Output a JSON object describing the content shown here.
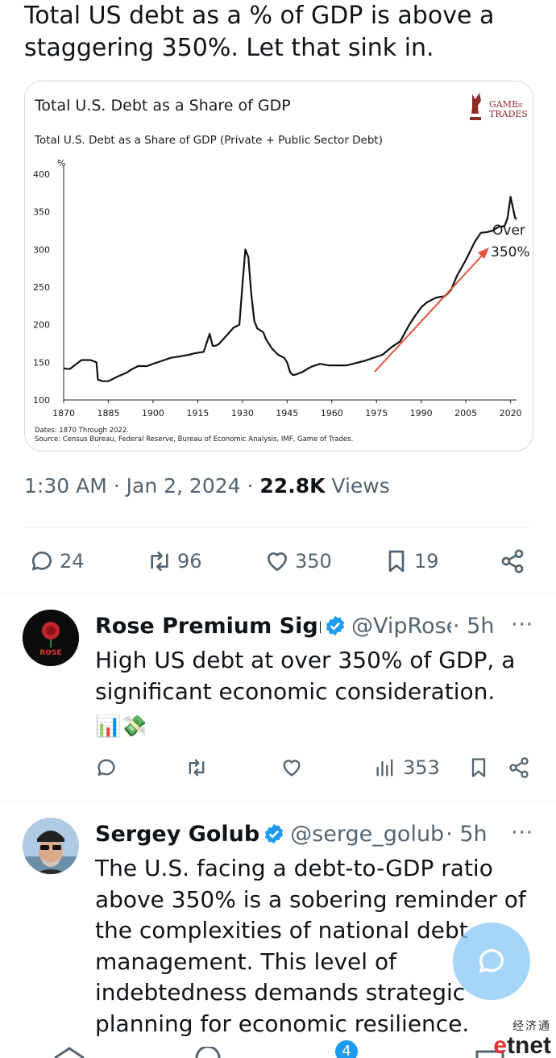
{
  "tweet": {
    "text": "Total US debt as a % of GDP is above a staggering 350%. Let that sink in.",
    "time": "1:30 AM",
    "date": "Jan 2, 2024",
    "views_count": "22.8K",
    "views_label": "Views",
    "replies": "24",
    "retweets": "96",
    "likes": "350",
    "bookmarks": "19"
  },
  "chart_data": {
    "type": "line",
    "title": "Total U.S. Debt as a Share of GDP",
    "subtitle": "Total U.S. Debt as a Share of GDP (Private + Public Sector Debt)",
    "ylabel": "%",
    "brand": "Game of Trades",
    "brand_line1": "GAME",
    "brand_of": "OF",
    "brand_line2": "TRADES",
    "annotation_line1": "Over",
    "annotation_line2": "350%",
    "footnote_dates": "Dates: 1870 Through 2022.",
    "footnote_source": "Source: Census Bureau, Federal Reserve, Bureau of Economic Analysis, IMF, Game of Trades.",
    "xlim": [
      1870,
      2022
    ],
    "ylim": [
      100,
      400
    ],
    "x_ticks": [
      1870,
      1885,
      1900,
      1915,
      1930,
      1945,
      1960,
      1975,
      1990,
      2005,
      2020
    ],
    "y_ticks": [
      100,
      150,
      200,
      250,
      300,
      350,
      400
    ],
    "grid": false,
    "line_color": "#111111",
    "arrow_color": "#e0523a",
    "series": [
      {
        "x": [
          1870,
          1872,
          1876,
          1879,
          1881,
          1881.5,
          1883,
          1885,
          1888,
          1891,
          1893,
          1895,
          1898,
          1900,
          1903,
          1906,
          1909,
          1912,
          1914,
          1917,
          1919,
          1920,
          1921,
          1922,
          1925,
          1927,
          1929,
          1930,
          1931,
          1932,
          1933,
          1934,
          1935,
          1937,
          1938,
          1940,
          1942,
          1944,
          1945,
          1946,
          1947,
          1948,
          1950,
          1953,
          1956,
          1959,
          1962,
          1965,
          1968,
          1971,
          1974,
          1977,
          1980,
          1983,
          1986,
          1988,
          1990,
          1992,
          1995,
          1998,
          2000,
          2002,
          2005,
          2008,
          2010,
          2012,
          2014,
          2016,
          2018,
          2019,
          2020,
          2020.8,
          2021.5,
          2022
        ],
        "y": [
          142,
          141,
          153,
          153,
          150,
          127,
          125,
          125,
          131,
          136,
          141,
          145,
          145,
          148,
          152,
          156,
          158,
          160,
          162,
          164,
          188,
          172,
          172,
          174,
          187,
          196,
          200,
          252,
          300,
          290,
          240,
          205,
          195,
          190,
          180,
          168,
          160,
          156,
          150,
          137,
          133,
          134,
          137,
          144,
          148,
          146,
          146,
          146,
          149,
          152,
          156,
          160,
          170,
          178,
          200,
          212,
          223,
          230,
          236,
          238,
          246,
          265,
          286,
          310,
          322,
          323,
          325,
          330,
          331,
          342,
          370,
          355,
          342,
          340
        ]
      }
    ]
  },
  "replies_list": [
    {
      "name": "Rose Premium Signals",
      "handle": "@VipRose",
      "time": "· 5h",
      "avatar_text": "ROSE",
      "body": "High US debt at over 350% of GDP, a significant economic consideration.",
      "emojis": "📊💸",
      "replies": "",
      "retweets": "",
      "likes": "",
      "views": "353"
    },
    {
      "name": "Sergey Golub",
      "handle": "@serge_golub",
      "time": "· 5h",
      "body": "The U.S. facing a debt-to-GDP ratio above 350% is a sobering reminder of the complexities of national debt management. This level of indebtedness demands strategic planning for economic resilience."
    }
  ],
  "more_label": "···",
  "notification_badge": "4",
  "watermark": {
    "chinese": "经济通",
    "logo_e": "e",
    "logo_rest": "tnet"
  },
  "colors": {
    "text": "#0f1419",
    "secondary": "#536471",
    "verified": "#1d9bf0",
    "divider": "#eff3f4"
  }
}
